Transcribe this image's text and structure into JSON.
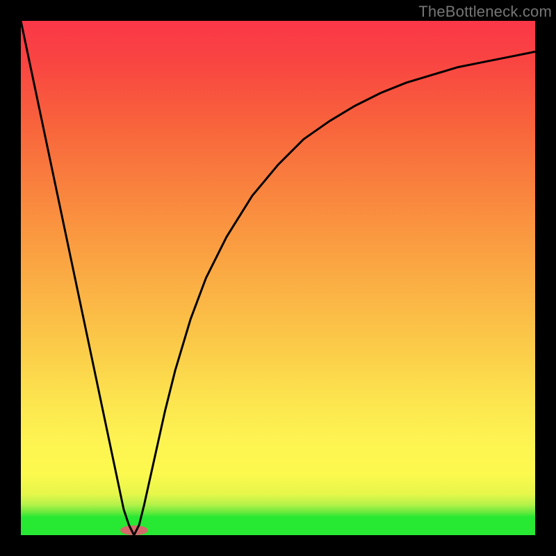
{
  "watermark": "TheBottleneck.com",
  "chart_data": {
    "type": "line",
    "title": "",
    "xlabel": "",
    "ylabel": "",
    "xlim": [
      0,
      100
    ],
    "ylim": [
      0,
      100
    ],
    "legend": false,
    "grid": false,
    "background_gradient": {
      "bottom_color": "#27e833",
      "top_color": "#fa3748",
      "type": "red-yellow-green"
    },
    "series": [
      {
        "name": "bottleneck-curve",
        "color": "#000000",
        "x": [
          0,
          2,
          4,
          6,
          8,
          10,
          12,
          14,
          16,
          18,
          20,
          21,
          22,
          23,
          24,
          26,
          28,
          30,
          33,
          36,
          40,
          45,
          50,
          55,
          60,
          65,
          70,
          75,
          80,
          85,
          90,
          95,
          100
        ],
        "y": [
          100,
          90.5,
          81,
          71.5,
          62,
          52.5,
          43,
          33.5,
          24,
          14.5,
          5,
          2,
          0,
          2,
          6,
          15,
          24,
          32,
          42,
          50,
          58,
          66,
          72,
          77,
          80.5,
          83.5,
          86,
          88,
          89.5,
          91,
          92,
          93,
          94
        ]
      }
    ],
    "marker": {
      "name": "optimal-point",
      "x": 22,
      "y": 0,
      "color": "#d46a6a",
      "shape": "pill"
    }
  },
  "colors": {
    "frame": "#000000",
    "curve": "#000000",
    "watermark": "#767676"
  }
}
